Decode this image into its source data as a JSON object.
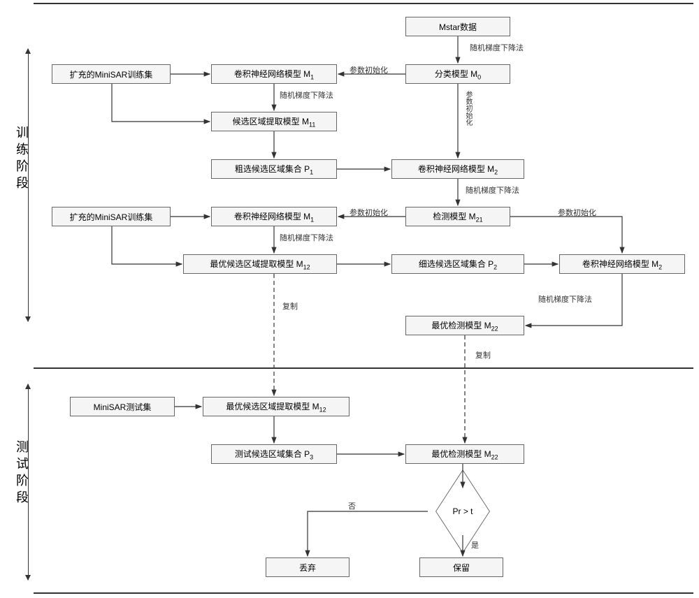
{
  "phases": {
    "train": "训练阶段",
    "test": "测试阶段"
  },
  "boxes": {
    "mstar": "Mstar数据",
    "m0": "分类模型 M",
    "m0_sub": "0",
    "aug1": "扩充的MiniSAR训练集",
    "m1_top": "卷积神经网络模型 M",
    "m1_top_sub": "1",
    "m11": "候选区域提取模型 M",
    "m11_sub": "11",
    "p1": "粗选候选区域集合 P",
    "p1_sub": "1",
    "m2_top": "卷积神经网络模型 M",
    "m2_top_sub": "2",
    "m21": "检测模型 M",
    "m21_sub": "21",
    "aug2": "扩充的MiniSAR训练集",
    "m1_bot": "卷积神经网络模型 M",
    "m1_bot_sub": "1",
    "m12": "最优候选区域提取模型 M",
    "m12_sub": "12",
    "p2": "细选候选区域集合  P",
    "p2_sub": "2",
    "m2_bot": "卷积神经网络模型 M",
    "m2_bot_sub": "2",
    "m22": "最优检测模型 M",
    "m22_sub": "22",
    "testset": "MiniSAR测试集",
    "m12_test": "最优候选区域提取模型 M",
    "m12_test_sub": "12",
    "p3": "测试候选区域集合 P",
    "p3_sub": "3",
    "m22_test": "最优检测模型 M",
    "m22_test_sub": "22",
    "discard": "丢弃",
    "keep": "保留"
  },
  "diamond": {
    "cond": "Pr > t"
  },
  "edges": {
    "sgd": "随机梯度下降法",
    "init": "参数初始化",
    "init_v": "参数初始化",
    "copy": "复制",
    "no": "否",
    "yes": "是"
  }
}
